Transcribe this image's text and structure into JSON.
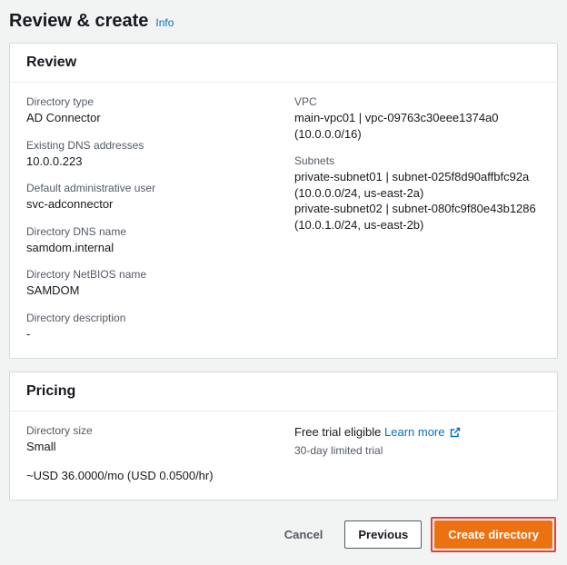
{
  "header": {
    "title": "Review & create",
    "info": "Info"
  },
  "review": {
    "title": "Review",
    "left": [
      {
        "label": "Directory type",
        "value": "AD Connector"
      },
      {
        "label": "Existing DNS addresses",
        "value": "10.0.0.223"
      },
      {
        "label": "Default administrative user",
        "value": "svc-adconnector"
      },
      {
        "label": "Directory DNS name",
        "value": "samdom.internal"
      },
      {
        "label": "Directory NetBIOS name",
        "value": "SAMDOM"
      },
      {
        "label": "Directory description",
        "value": "-"
      }
    ],
    "right": [
      {
        "label": "VPC",
        "value": "main-vpc01 | vpc-09763c30eee1374a0 (10.0.0.0/16)"
      },
      {
        "label": "Subnets",
        "value": "private-subnet01 | subnet-025f8d90affbfc92a (10.0.0.0/24, us-east-2a)\nprivate-subnet02 | subnet-080fc9f80e43b1286 (10.0.1.0/24, us-east-2b)"
      }
    ]
  },
  "pricing": {
    "title": "Pricing",
    "left": {
      "size_label": "Directory size",
      "size_value": "Small",
      "cost": "~USD 36.0000/mo (USD 0.0500/hr)"
    },
    "right": {
      "trial_text": "Free trial eligible",
      "learn_more": "Learn more",
      "trial_note": "30-day limited trial"
    }
  },
  "actions": {
    "cancel": "Cancel",
    "previous": "Previous",
    "create": "Create directory"
  }
}
